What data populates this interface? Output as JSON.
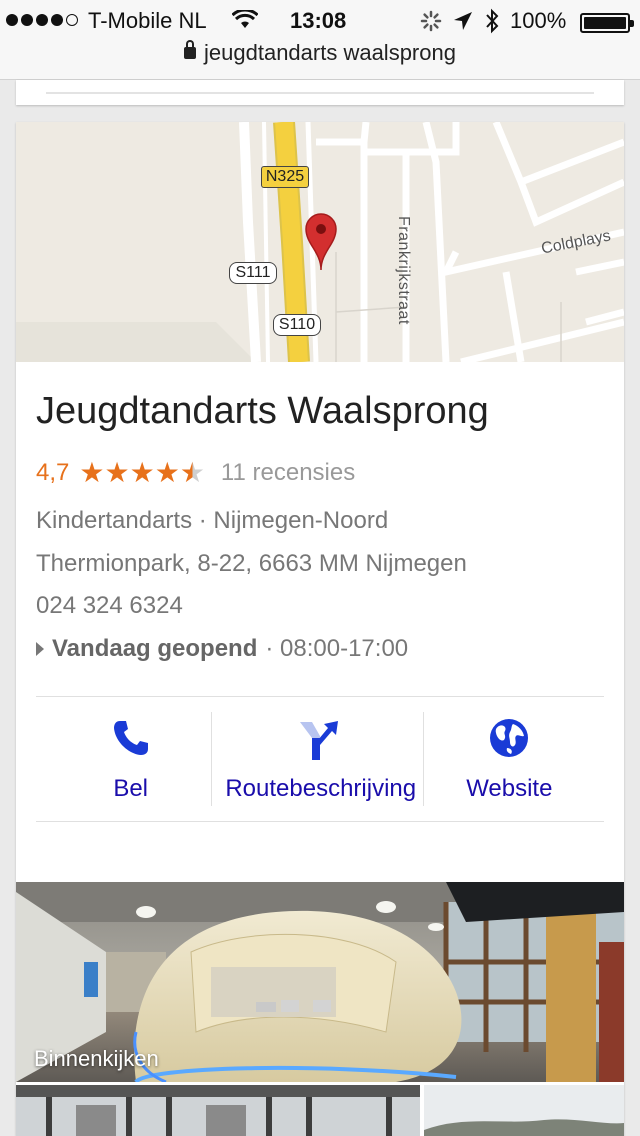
{
  "status_bar": {
    "carrier": "T-Mobile NL",
    "time": "13:08",
    "battery": "100%"
  },
  "browser": {
    "url": "jeugdtandarts waalsprong"
  },
  "map": {
    "road_n325": "N325",
    "road_s111": "S111",
    "road_s110": "S110",
    "street_frankrijkstraat": "Frankrijkstraat",
    "street_coldplays": "Coldplays"
  },
  "place": {
    "name": "Jeugdtandarts Waalsprong",
    "rating": "4,7",
    "rating_value": 4.7,
    "rating_max": 5,
    "reviews": "11 recensies",
    "category": "Kindertandarts · Nijmegen-Noord",
    "address": "Thermionpark, 8-22, 6663 MM Nijmegen",
    "phone": "024 324 6324",
    "hours_status": "Vandaag geopend",
    "hours_range": "· 08:00-17:00"
  },
  "actions": [
    {
      "label": "Bel",
      "icon": "phone-icon"
    },
    {
      "label": "Routebeschrijving",
      "icon": "directions-icon"
    },
    {
      "label": "Website",
      "icon": "globe-icon"
    }
  ],
  "photo": {
    "label": "Binnenkijken"
  },
  "colors": {
    "rating": "#e7711b",
    "link": "#1a0dab",
    "road_yellow": "#f4d03f",
    "pin_red": "#d32f2f"
  }
}
